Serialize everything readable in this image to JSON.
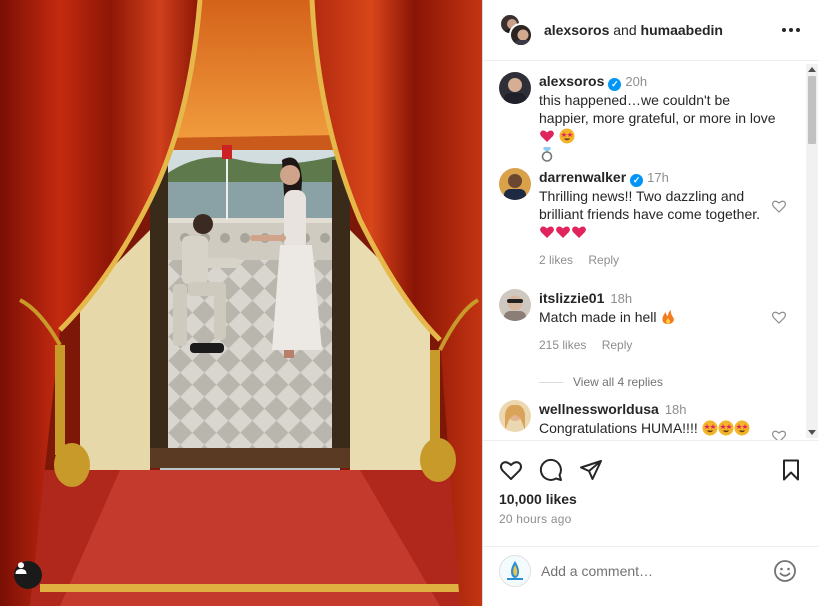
{
  "post": {
    "author": "alexsoros",
    "coauthor_joiner": "and",
    "coauthor": "humaabedin",
    "more_icon": "more-horizontal-icon"
  },
  "comments": [
    {
      "user": "alexsoros",
      "verified": true,
      "time": "20h",
      "text": "this happened…we couldn't be happier, more grateful, or more in love",
      "emoji": [
        "red-heart",
        "star-struck",
        "ring"
      ]
    },
    {
      "user": "darrenwalker",
      "verified": true,
      "time": "17h",
      "text": "Thrilling news!! Two dazzling and brilliant friends have come together.",
      "emoji": [
        "red-heart",
        "red-heart",
        "red-heart"
      ],
      "likes": "2 likes",
      "reply": "Reply"
    },
    {
      "user": "itslizzie01",
      "verified": false,
      "time": "18h",
      "text": "Match made in hell",
      "emoji": [
        "fire"
      ],
      "likes": "215 likes",
      "reply": "Reply"
    },
    {
      "user": "wellnessworldusa",
      "verified": false,
      "time": "18h",
      "text": "Congratulations HUMA!!!!",
      "emoji": [
        "star-struck",
        "star-struck",
        "star-struck"
      ]
    }
  ],
  "view_replies": "View all 4 replies",
  "actions": {
    "like_icon": "heart-icon",
    "comment_icon": "comment-icon",
    "share_icon": "share-icon",
    "save_icon": "bookmark-icon"
  },
  "likes": "10,000 likes",
  "posted": "20 hours ago",
  "add_comment": {
    "placeholder": "Add a comment…"
  },
  "colors": {
    "verified": "#0095f6",
    "heart": "#e0245e",
    "link_gray": "#8e8e8e"
  }
}
